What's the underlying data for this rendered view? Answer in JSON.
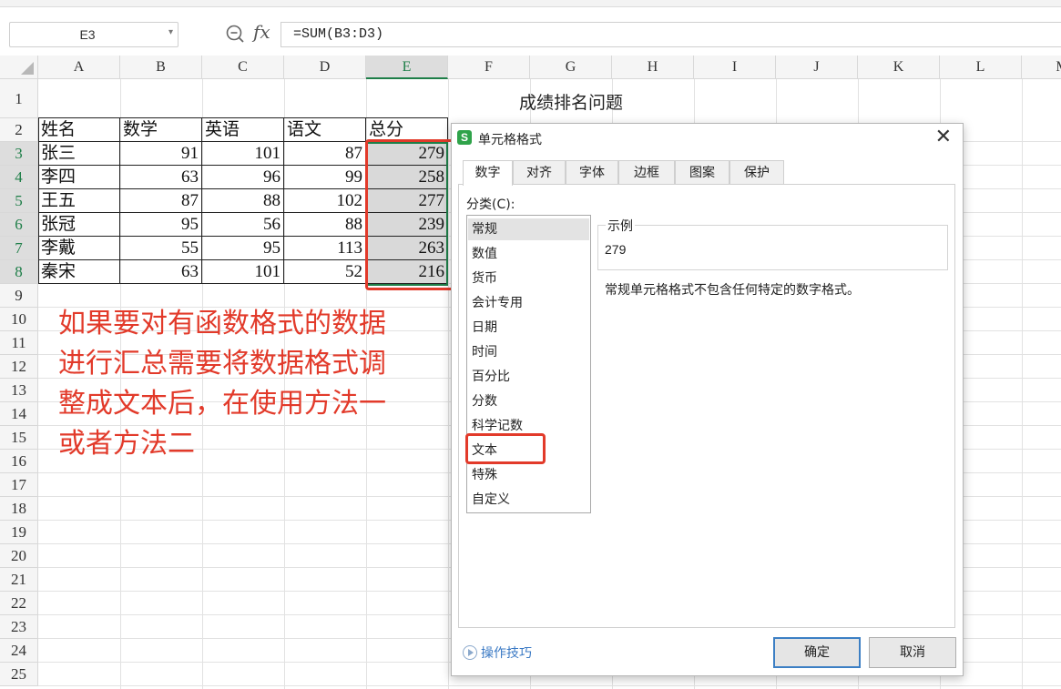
{
  "name_box": "E3",
  "formula": "=SUM(B3:D3)",
  "columns": [
    "A",
    "B",
    "C",
    "D",
    "E",
    "F",
    "G",
    "H",
    "I",
    "J",
    "K",
    "L",
    "M"
  ],
  "rows": [
    "1",
    "2",
    "3",
    "4",
    "5",
    "6",
    "7",
    "8",
    "9",
    "10",
    "11",
    "12",
    "13",
    "14",
    "15",
    "16",
    "17",
    "18",
    "19",
    "20",
    "21",
    "22",
    "23",
    "24",
    "25"
  ],
  "sheet": {
    "title": "成绩排名问题",
    "headers": [
      "姓名",
      "数学",
      "英语",
      "语文",
      "总分"
    ],
    "data": [
      [
        "张三",
        "91",
        "101",
        "87",
        "279"
      ],
      [
        "李四",
        "63",
        "96",
        "99",
        "258"
      ],
      [
        "王五",
        "87",
        "88",
        "102",
        "277"
      ],
      [
        "张冠",
        "95",
        "56",
        "88",
        "239"
      ],
      [
        "李戴",
        "55",
        "95",
        "113",
        "263"
      ],
      [
        "秦宋",
        "63",
        "101",
        "52",
        "216"
      ]
    ]
  },
  "annotation": [
    "如果要对有函数格式的数据",
    "进行汇总需要将数据格式调",
    "整成文本后，在使用方法一",
    "或者方法二"
  ],
  "dialog": {
    "title": "单元格格式",
    "logo": "S",
    "close": "✕",
    "tabs": [
      "数字",
      "对齐",
      "字体",
      "边框",
      "图案",
      "保护"
    ],
    "active_tab": "数字",
    "category_label": "分类(C):",
    "categories": [
      "常规",
      "数值",
      "货币",
      "会计专用",
      "日期",
      "时间",
      "百分比",
      "分数",
      "科学记数",
      "文本",
      "特殊",
      "自定义"
    ],
    "selected_category": "常规",
    "sample_label": "示例",
    "sample_value": "279",
    "description": "常规单元格格式不包含任何特定的数字格式。",
    "tips": "操作技巧",
    "ok": "确定",
    "cancel": "取消"
  },
  "colors": {
    "accent_green": "#1e7e48",
    "annotation_red": "#e23a2a",
    "link_blue": "#3a79c4"
  },
  "icons": [
    "zoom-icon",
    "fx-icon",
    "dropdown-arrow-icon",
    "close-icon",
    "app-logo-icon",
    "play-circle-icon"
  ]
}
